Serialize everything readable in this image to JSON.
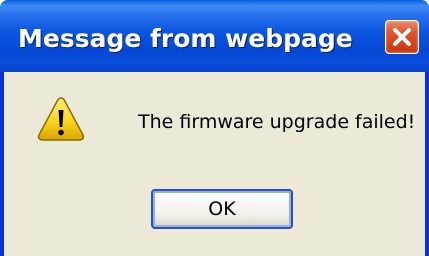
{
  "dialog": {
    "title": "Message from webpage",
    "message": "The firmware upgrade failed!",
    "icon": "warning-icon",
    "ok_label": "OK"
  },
  "colors": {
    "titlebar": "#0b55e0",
    "body": "#ece9d8",
    "close_button": "#e2552b"
  }
}
